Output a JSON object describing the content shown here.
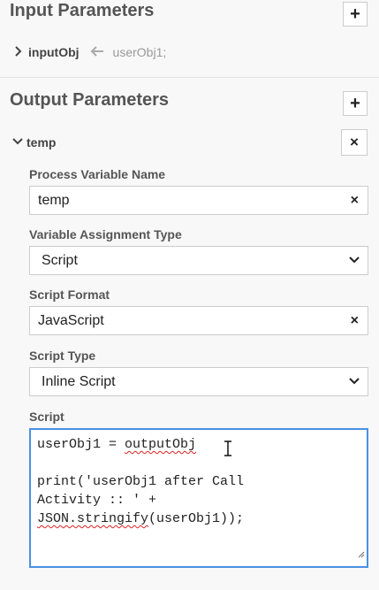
{
  "input_parameters": {
    "title": "Input Parameters",
    "add_label": "+",
    "items": [
      {
        "name": "inputObj",
        "value": "userObj1;"
      }
    ]
  },
  "output_parameters": {
    "title": "Output Parameters",
    "add_label": "+",
    "item": {
      "name": "temp",
      "remove_label": "×",
      "fields": {
        "process_variable_name": {
          "label": "Process Variable Name",
          "value": "temp",
          "clear_label": "×"
        },
        "variable_assignment_type": {
          "label": "Variable Assignment Type",
          "value": "Script"
        },
        "script_format": {
          "label": "Script Format",
          "value": "JavaScript",
          "clear_label": "×"
        },
        "script_type": {
          "label": "Script Type",
          "value": "Inline Script"
        },
        "script": {
          "label": "Script",
          "lines": {
            "l1_prefix": "userObj1 = ",
            "l1_word": "outputObj",
            "l3": "print('userObj1 after Call",
            "l4": "Activity :: ' +",
            "l5_word": "JSON.stringify",
            "l5_rest": "(userObj1));"
          }
        }
      }
    }
  },
  "icons": {
    "chevron_right": "chevron-right-icon",
    "chevron_down": "chevron-down-icon",
    "arrow_left": "arrow-left-icon",
    "dropdown": "dropdown-chevron-icon",
    "resize": "resize-handle-icon",
    "cursor": "text-cursor-icon"
  },
  "colors": {
    "focus_border": "#4a90e2",
    "spellcheck": "#dd2222"
  }
}
